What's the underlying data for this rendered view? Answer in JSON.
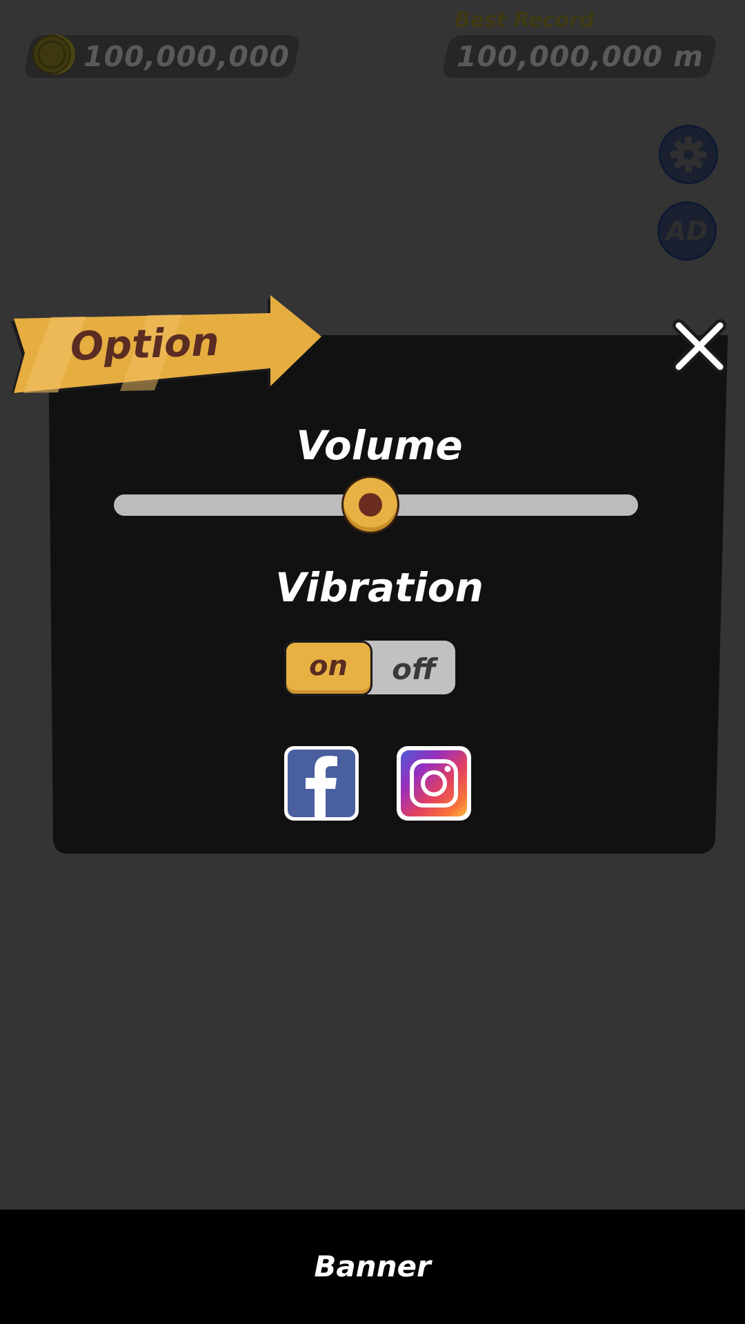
{
  "hud": {
    "coins": "100,000,000",
    "best_record_label": "Best Record",
    "best_record_value": "100,000,000 m",
    "settings_icon": "gear-icon",
    "ad_label": "AD"
  },
  "dialog": {
    "title": "Option",
    "close_icon": "close-icon",
    "volume_label": "Volume",
    "volume_level": 0.49,
    "vibration_label": "Vibration",
    "vibration_on_label": "on",
    "vibration_off_label": "off",
    "vibration_state": "on",
    "social": [
      "facebook-icon",
      "instagram-icon"
    ]
  },
  "banner": {
    "label": "Banner"
  },
  "colors": {
    "accent": "#e8b143",
    "accent_dark": "#5a2c22",
    "dialog_bg": "#111111",
    "overlay_bg": "#343434",
    "facebook": "#4a5fa0"
  }
}
